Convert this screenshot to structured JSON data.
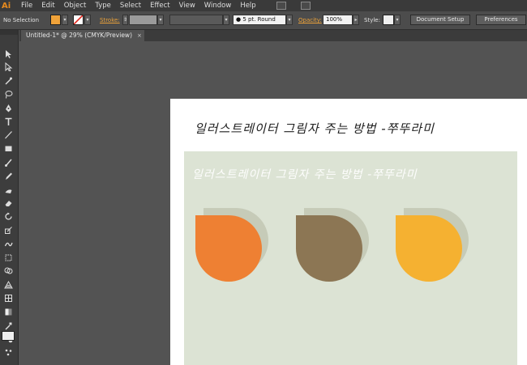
{
  "app": {
    "logo": "Ai",
    "menu": [
      "File",
      "Edit",
      "Object",
      "Type",
      "Select",
      "Effect",
      "View",
      "Window",
      "Help"
    ]
  },
  "control": {
    "selection": "No Selection",
    "stroke_label": "Stroke:",
    "brush_label": "5 pt. Round",
    "opacity_label": "Opacity:",
    "opacity_value": "100%",
    "style_label": "Style:",
    "doc_setup": "Document Setup",
    "preferences": "Preferences",
    "fill_color": "#f0a33a"
  },
  "document": {
    "tab_title": "Untitled-1* @ 29% (CMYK/Preview)",
    "tab_close": "×"
  },
  "artboard": {
    "title": "일러스트레이터 그림자 주는 방법 -쭈뚜라미",
    "panel_title": "일러스트레이터 그림자 주는 방법 -쭈뚜라미",
    "panel_color": "#dce3d4",
    "shadow_color": "#c6cbb8",
    "drops": [
      {
        "name": "orange",
        "color": "#ee8033"
      },
      {
        "name": "brown",
        "color": "#8c7654"
      },
      {
        "name": "yellow",
        "color": "#f5b131"
      }
    ]
  },
  "tools": [
    "selection-tool-icon",
    "direct-selection-tool-icon",
    "magic-wand-tool-icon",
    "lasso-tool-icon",
    "pen-tool-icon",
    "type-tool-icon",
    "line-tool-icon",
    "rectangle-tool-icon",
    "paintbrush-tool-icon",
    "pencil-tool-icon",
    "blob-brush-tool-icon",
    "eraser-tool-icon",
    "rotate-tool-icon",
    "scale-tool-icon",
    "warp-tool-icon",
    "free-transform-tool-icon",
    "shape-builder-tool-icon",
    "perspective-grid-tool-icon",
    "mesh-tool-icon",
    "gradient-tool-icon",
    "eyedropper-tool-icon",
    "blend-tool-icon",
    "symbol-sprayer-tool-icon"
  ]
}
